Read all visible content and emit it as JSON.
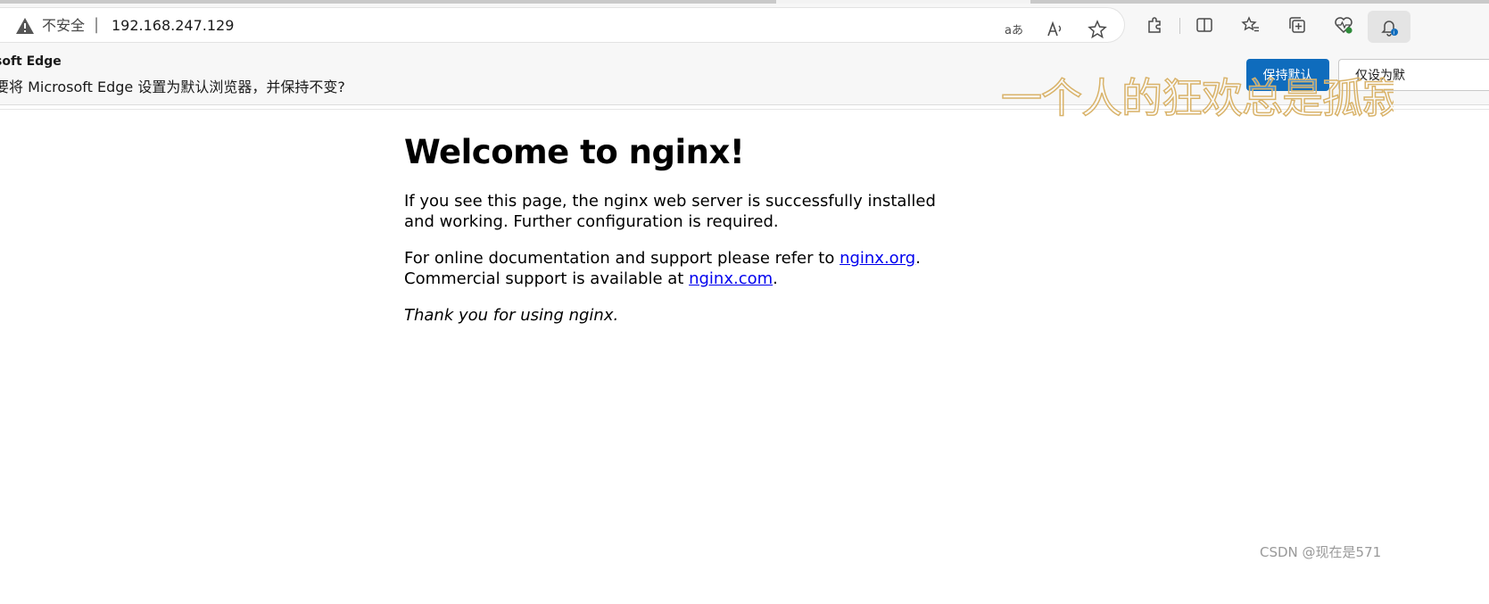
{
  "browser": {
    "security_label": "不安全",
    "separator": "|",
    "url": "192.168.247.129",
    "toolbar_icons": [
      "read-aloud-translate-icon",
      "read-aloud-icon",
      "favorite-star-icon",
      "extensions-icon",
      "split-screen-icon",
      "favorites-icon",
      "collections-icon",
      "browser-essentials-icon",
      "notifications-icon"
    ]
  },
  "infobar": {
    "title": "soft Edge",
    "message": "要将 Microsoft Edge 设置为默认浏览器，并保持不变?",
    "keep_default_label": "保持默认",
    "set_only_label": "仅设为默"
  },
  "overlay": {
    "watermark_text": "一个人的狂欢总是孤寂",
    "csdn_mark": "CSDN @现在是571"
  },
  "page": {
    "heading": "Welcome to nginx!",
    "para1": "If you see this page, the nginx web server is successfully installed and working. Further configuration is required.",
    "para2_prefix": "For online documentation and support please refer to ",
    "link_org": "nginx.org",
    "para2_mid": ".",
    "para3_prefix": "Commercial support is available at ",
    "link_com": "nginx.com",
    "para3_suffix": ".",
    "thanks": "Thank you for using nginx."
  },
  "colors": {
    "link": "#0000ee",
    "primary_button": "#0f6cbd",
    "watermark_stroke": "#d9b36a"
  }
}
